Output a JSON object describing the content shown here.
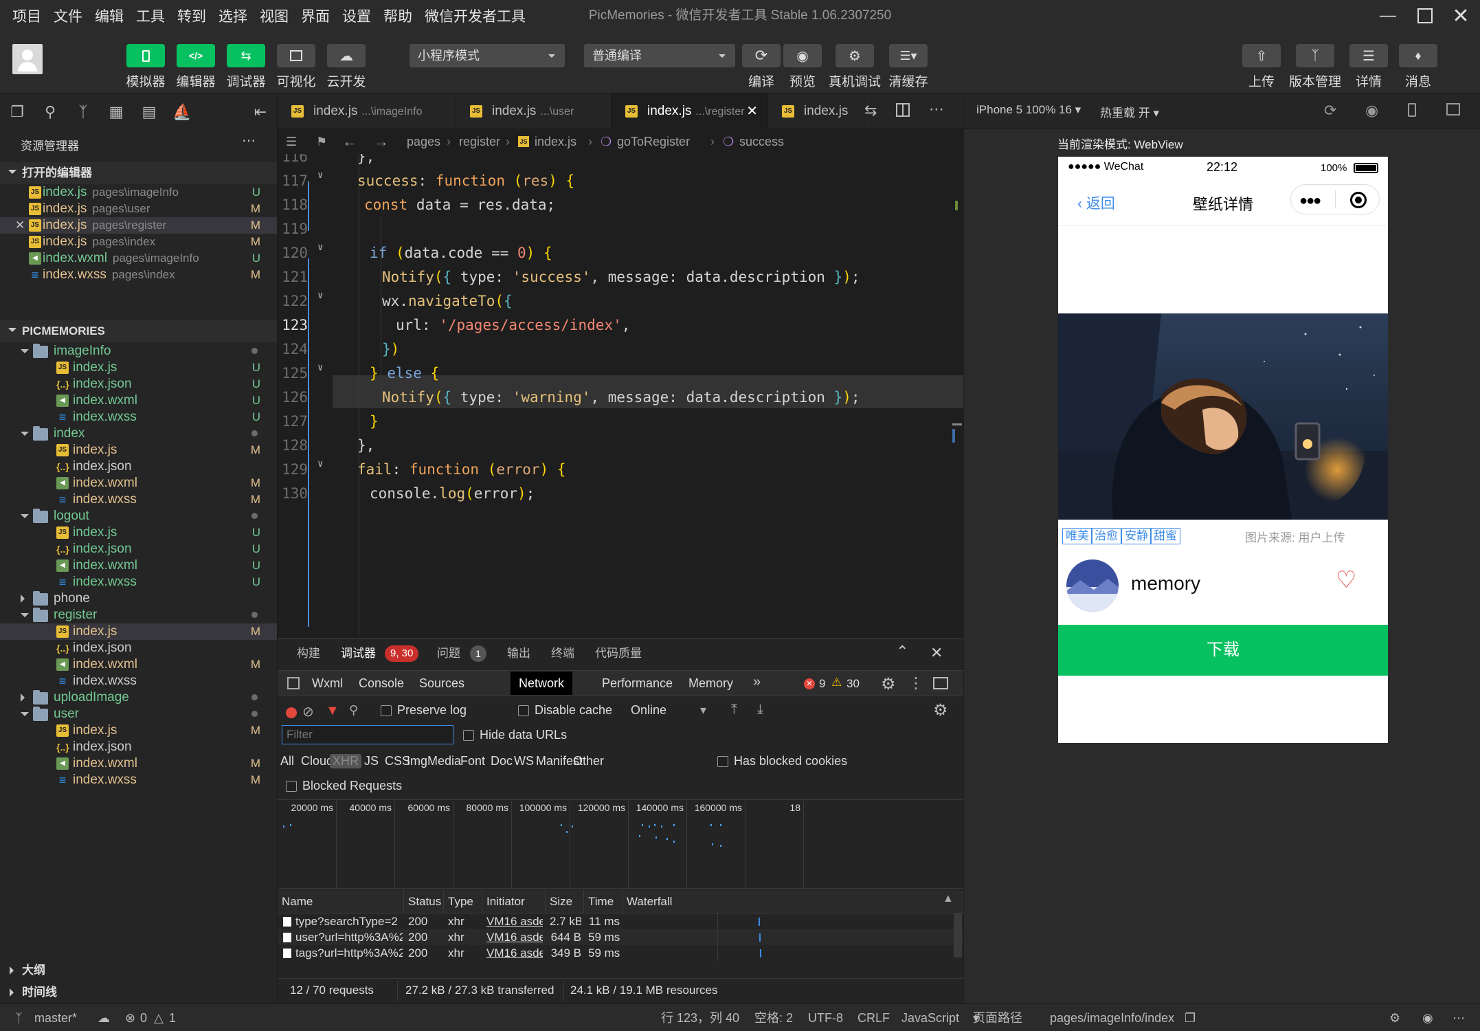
{
  "menu": [
    "项目",
    "文件",
    "编辑",
    "工具",
    "转到",
    "选择",
    "视图",
    "界面",
    "设置",
    "帮助",
    "微信开发者工具"
  ],
  "app_title": "PicMemories - 微信开发者工具 Stable 1.06.2307250",
  "toolbar": {
    "left": [
      "模拟器",
      "编辑器",
      "调试器",
      "可视化",
      "云开发"
    ],
    "mode": "小程序模式",
    "compile": "普通编译",
    "actions": [
      "编译",
      "预览",
      "真机调试",
      "清缓存"
    ],
    "right": [
      "上传",
      "版本管理",
      "详情",
      "消息"
    ]
  },
  "explorer": {
    "title": "资源管理器",
    "open_editors": "打开的编辑器",
    "open": [
      {
        "name": "index.js",
        "path": "pages\\imageInfo",
        "status": "U"
      },
      {
        "name": "index.js",
        "path": "pages\\user",
        "status": "M"
      },
      {
        "name": "index.js",
        "path": "pages\\register",
        "status": "M"
      },
      {
        "name": "index.js",
        "path": "pages\\index",
        "status": "M"
      },
      {
        "name": "index.wxml",
        "path": "pages\\imageInfo",
        "status": "U"
      },
      {
        "name": "index.wxss",
        "path": "pages\\index",
        "status": "M"
      }
    ],
    "project": "PICMEMORIES",
    "tree": [
      {
        "name": "imageInfo",
        "kind": "folder",
        "open": true,
        "dot": true
      },
      {
        "name": "index.js",
        "kind": "js",
        "status": "U"
      },
      {
        "name": "index.json",
        "kind": "json",
        "status": "U"
      },
      {
        "name": "index.wxml",
        "kind": "wxml",
        "status": "U"
      },
      {
        "name": "index.wxss",
        "kind": "wxss",
        "status": "U"
      },
      {
        "name": "index",
        "kind": "folder",
        "open": true,
        "dot": true
      },
      {
        "name": "index.js",
        "kind": "js",
        "status": "M"
      },
      {
        "name": "index.json",
        "kind": "json",
        "status": ""
      },
      {
        "name": "index.wxml",
        "kind": "wxml",
        "status": "M"
      },
      {
        "name": "index.wxss",
        "kind": "wxss",
        "status": "M"
      },
      {
        "name": "logout",
        "kind": "folder",
        "open": true,
        "dot": true
      },
      {
        "name": "index.js",
        "kind": "js",
        "status": "U"
      },
      {
        "name": "index.json",
        "kind": "json",
        "status": "U"
      },
      {
        "name": "index.wxml",
        "kind": "wxml",
        "status": "U"
      },
      {
        "name": "index.wxss",
        "kind": "wxss",
        "status": "U"
      },
      {
        "name": "phone",
        "kind": "folder",
        "open": false,
        "dot": false
      },
      {
        "name": "register",
        "kind": "folder",
        "open": true,
        "dot": true
      },
      {
        "name": "index.js",
        "kind": "js",
        "status": "M"
      },
      {
        "name": "index.json",
        "kind": "json",
        "status": ""
      },
      {
        "name": "index.wxml",
        "kind": "wxml",
        "status": "M"
      },
      {
        "name": "index.wxss",
        "kind": "wxss",
        "status": ""
      },
      {
        "name": "uploadImage",
        "kind": "folder",
        "open": false,
        "dot": true
      },
      {
        "name": "user",
        "kind": "folder",
        "open": true,
        "dot": true
      },
      {
        "name": "index.js",
        "kind": "js",
        "status": "M"
      },
      {
        "name": "index.json",
        "kind": "json",
        "status": ""
      },
      {
        "name": "index.wxml",
        "kind": "wxml",
        "status": "M"
      },
      {
        "name": "index.wxss",
        "kind": "wxss",
        "status": "M"
      }
    ],
    "outline": "大纲",
    "timeline": "时间线"
  },
  "tabs": [
    {
      "name": "index.js",
      "sub": "...\\imageInfo"
    },
    {
      "name": "index.js",
      "sub": "...\\user"
    },
    {
      "name": "index.js",
      "sub": "...\\register"
    },
    {
      "name": "index.js",
      "sub": ""
    }
  ],
  "breadcrumb": [
    "pages",
    "register",
    "index.js",
    "goToRegister",
    "success"
  ],
  "code": {
    "line_numbers": [
      "116",
      "117",
      "118",
      "119",
      "120",
      "121",
      "122",
      "123",
      "124",
      "125",
      "126",
      "127",
      "128",
      "129",
      "130"
    ],
    "lines": [
      "},",
      "success: function (res) {",
      "const data = res.data;",
      "",
      "if (data.code == 0) {",
      "Notify({ type: 'success', message: data.description });",
      "wx.navigateTo({",
      "url: '/pages/access/index',",
      "})",
      "} else {",
      "Notify({ type: 'warning', message: data.description });",
      "}",
      "},",
      "fail: function (error) {",
      "console.log(error);"
    ]
  },
  "panel": {
    "tabs": [
      "构建",
      "调试器",
      "问题",
      "输出",
      "终端",
      "代码质量"
    ],
    "debugger_badge": "9, 30",
    "problems_badge": "1",
    "devtools_tabs": [
      "Wxml",
      "Console",
      "Sources",
      "Network",
      "Performance",
      "Memory"
    ],
    "errors": "9",
    "warnings": "30",
    "preserve_log": "Preserve log",
    "disable_cache": "Disable cache",
    "throttle": "Online",
    "filter_placeholder": "Filter",
    "hide_data_urls": "Hide data URLs",
    "filter_types": [
      "All",
      "Cloud",
      "XHR",
      "JS",
      "CSS",
      "Img",
      "Media",
      "Font",
      "Doc",
      "WS",
      "Manifest",
      "Other"
    ],
    "has_blocked_cookies": "Has blocked cookies",
    "blocked_requests": "Blocked Requests",
    "timeline_ticks": [
      "20000 ms",
      "40000 ms",
      "60000 ms",
      "80000 ms",
      "100000 ms",
      "120000 ms",
      "140000 ms",
      "160000 ms",
      "18"
    ],
    "columns": [
      "Name",
      "Status",
      "Type",
      "Initiator",
      "Size",
      "Time",
      "Waterfall"
    ],
    "rows": [
      {
        "name": "type?searchType=2",
        "status": "200",
        "type": "xhr",
        "initiator": "VM16 asdeb...",
        "size": "2.7 kB",
        "time": "11 ms"
      },
      {
        "name": "user?url=http%3A%2F%2...",
        "status": "200",
        "type": "xhr",
        "initiator": "VM16 asdeb...",
        "size": "644 B",
        "time": "59 ms"
      },
      {
        "name": "tags?url=http%3A%2F%2...",
        "status": "200",
        "type": "xhr",
        "initiator": "VM16 asdeb...",
        "size": "349 B",
        "time": "59 ms"
      }
    ],
    "summary": [
      "12 / 70 requests",
      "27.2 kB / 27.3 kB transferred",
      "24.1 kB / 19.1 MB resources"
    ]
  },
  "simulator": {
    "device": "iPhone 5 100% 16",
    "hot_reload": "热重载 开",
    "render_mode": "当前渲染模式: WebView",
    "status_carrier": "●●●●● WeChat",
    "status_time": "22:12",
    "status_battery": "100%",
    "back": "返回",
    "page_title": "壁纸详情",
    "tags": [
      "唯美",
      "治愈",
      "安静",
      "甜蜜"
    ],
    "source": "图片来源:  用户上传",
    "username": "memory",
    "download": "下载"
  },
  "statusbar": {
    "branch": "master*",
    "errors": "0",
    "warnings": "1",
    "position": "行 123，列 40",
    "spaces": "空格: 2",
    "encoding": "UTF-8",
    "eol": "CRLF",
    "language": "JavaScript",
    "page_path_label": "页面路径",
    "page_path": "pages/imageInfo/index"
  },
  "colors": {
    "accent_green": "#07c160",
    "link_blue": "#3d8be6",
    "heart_red": "#e64340"
  }
}
